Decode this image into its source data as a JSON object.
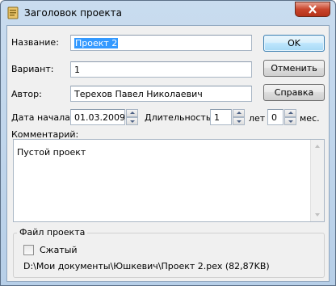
{
  "window": {
    "title": "Заголовок проекта"
  },
  "form": {
    "name_label": "Название:",
    "name_value": "Проект 2",
    "variant_label": "Вариант:",
    "variant_value": "1",
    "author_label": "Автор:",
    "author_value": "Терехов Павел Николаевич",
    "start_label": "Дата начала:",
    "start_value": "01.03.2009",
    "duration_label": "Длительность:",
    "years_value": "1",
    "years_unit": "лет",
    "months_value": "0",
    "months_unit": "мес.",
    "comment_label": "Комментарий:",
    "comment_value": "Пустой проект"
  },
  "buttons": {
    "ok": "OK",
    "cancel": "Отменить",
    "help": "Справка"
  },
  "project_file": {
    "legend": "Файл проекта",
    "compressed_label": "Сжатый",
    "compressed_checked": false,
    "path": "D:\\Мои документы\\Юшкевич\\Проект 2.pex (82,87KB)"
  },
  "icons": {
    "app": "project-icon",
    "close": "close-icon"
  }
}
